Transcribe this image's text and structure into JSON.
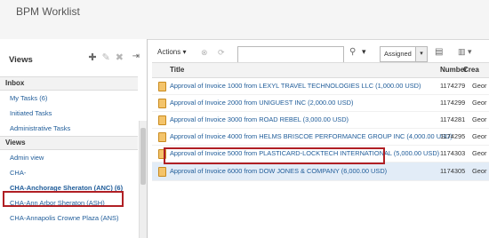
{
  "app": {
    "title": "BPM Worklist"
  },
  "views_panel": {
    "title": "Views",
    "add_icon": "plus-icon",
    "edit_icon": "pencil-icon",
    "delete_icon": "x-icon",
    "collapse_icon": "collapse-arrow-icon",
    "inbox_header": "Inbox",
    "inbox_items": [
      "My Tasks (6)",
      "Initiated Tasks",
      "Administrative Tasks"
    ],
    "views_header": "Views",
    "views_items": [
      "Admin view",
      "CHA-",
      "CHA-Anchorage Sheraton (ANC) (6)",
      "CHA-Ann Arbor Sheraton (ASH)",
      "CHA-Annapolis Crowne Plaza (ANS)"
    ]
  },
  "toolbar": {
    "actions_label": "Actions ▾",
    "search_value": "",
    "assigned_value": "Assigned"
  },
  "table": {
    "columns": [
      "Title",
      "Number",
      "Crea"
    ],
    "rows": [
      {
        "title": "Approval of Invoice 1000 from LEXYL TRAVEL TECHNOLOGIES LLC (1,000.00 USD)",
        "number": "1174279",
        "created": "Geor"
      },
      {
        "title": "Approval of Invoice 2000 from UNIGUEST INC (2,000.00 USD)",
        "number": "1174299",
        "created": "Geor"
      },
      {
        "title": "Approval of Invoice 3000 from ROAD REBEL (3,000.00 USD)",
        "number": "1174281",
        "created": "Geor"
      },
      {
        "title": "Approval of Invoice 4000 from HELMS BRISCOE PERFORMANCE GROUP INC (4,000.00 USD)",
        "number": "1174295",
        "created": "Geor"
      },
      {
        "title": "Approval of Invoice 5000 from PLASTICARD-LOCKTECH INTERNATIONAL (5,000.00 USD)",
        "number": "1174303",
        "created": "Geor"
      },
      {
        "title": "Approval of Invoice 6000 from DOW JONES & COMPANY (6,000.00 USD)",
        "number": "1174305",
        "created": "Geor"
      }
    ]
  },
  "colors": {
    "link": "#1f5c99",
    "highlight": "#b01f24",
    "selected_row": "#e2ecf7"
  }
}
